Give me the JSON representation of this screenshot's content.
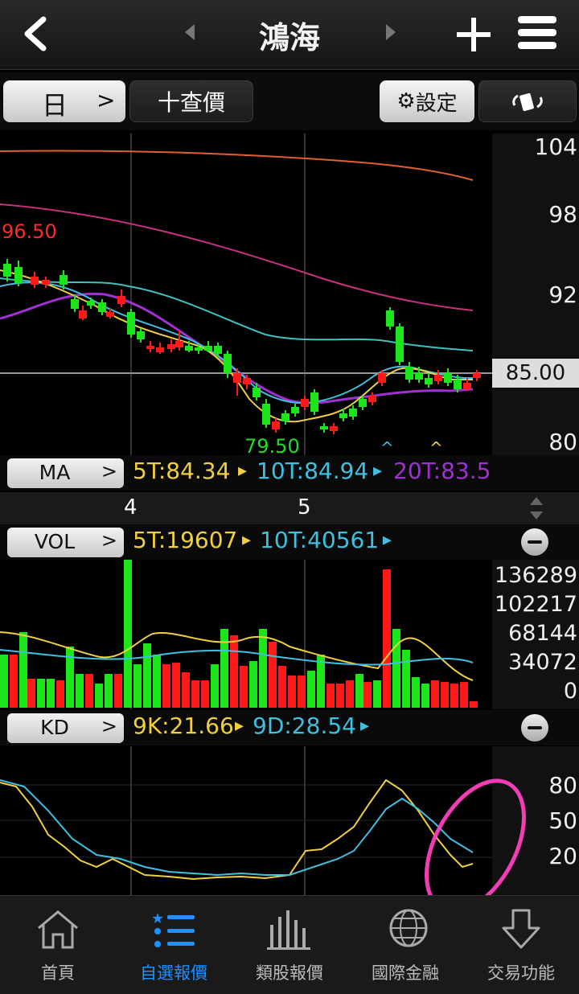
{
  "header": {
    "title": "鴻海"
  },
  "toolbar": {
    "period_label": "日",
    "query_label": "十查價",
    "settings_label": "設定"
  },
  "price_chart": {
    "y_labels": [
      "104",
      "98",
      "92",
      "85.00",
      "80"
    ],
    "high_label": "96.50",
    "low_label": "79.50",
    "current_price": "85.00"
  },
  "ma": {
    "button": "MA",
    "ma5": "5T:84.34",
    "ma10": "10T:84.94",
    "ma20": "20T:83.5"
  },
  "date_axis": {
    "labels": [
      "4",
      "5"
    ]
  },
  "vol": {
    "button": "VOL",
    "ma5": "5T:19607",
    "ma10": "10T:40561",
    "y_labels": [
      "136289",
      "102217",
      "68144",
      "34072",
      "0"
    ]
  },
  "kd": {
    "button": "KD",
    "k": "9K:21.66",
    "d": "9D:28.54",
    "y_labels": [
      "80",
      "50",
      "20"
    ]
  },
  "tabs": [
    {
      "label": "首頁",
      "icon": "home-icon",
      "active": false
    },
    {
      "label": "自選報價",
      "icon": "list-icon",
      "active": true
    },
    {
      "label": "類股報價",
      "icon": "bar-chart-icon",
      "active": false
    },
    {
      "label": "國際金融",
      "icon": "globe-icon",
      "active": false
    },
    {
      "label": "交易功能",
      "icon": "download-arrow-icon",
      "active": false
    }
  ],
  "colors": {
    "up": "#ff1a1a",
    "down": "#1ae61a",
    "ma5": "#f0d040",
    "ma10": "#40c0e0",
    "ma20": "#a030d0",
    "active_tab": "#1e90ff",
    "highlight": "#ff40c0"
  }
}
